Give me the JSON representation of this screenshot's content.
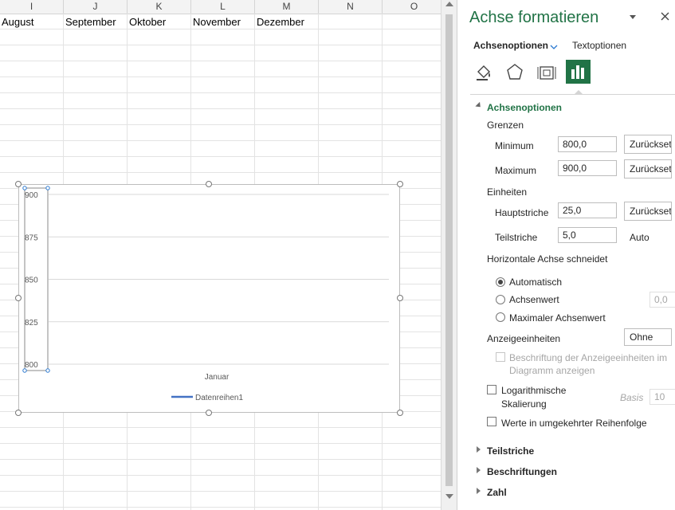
{
  "sheet": {
    "columns": [
      "I",
      "J",
      "K",
      "L",
      "M",
      "N",
      "O"
    ],
    "row1": [
      "August",
      "September",
      "Oktober",
      "November",
      "Dezember"
    ]
  },
  "chart": {
    "category_label": "Januar",
    "legend": "Datenreihen1",
    "series_color": "#4472c4"
  },
  "chart_data": {
    "type": "line",
    "categories": [
      "Januar"
    ],
    "series": [
      {
        "name": "Datenreihen1",
        "values": []
      }
    ],
    "ylim": [
      800,
      900
    ],
    "yticks": [
      900,
      875,
      850,
      825,
      800
    ],
    "grid": true,
    "legend_position": "bottom"
  },
  "pane": {
    "title": "Achse formatieren",
    "tab_axis": "Achsenoptionen",
    "tab_text": "Textoptionen",
    "accent": "#217346",
    "section_axis": "Achsenoptionen",
    "bounds": {
      "header": "Grenzen",
      "min_label": "Minimum",
      "min_value": "800,0",
      "min_btn": "Zurücksetzen",
      "max_label": "Maximum",
      "max_value": "900,0",
      "max_btn": "Zurücksetzen"
    },
    "units": {
      "header": "Einheiten",
      "major_label": "Hauptstriche",
      "major_value": "25,0",
      "major_btn": "Zurücksetzen",
      "minor_label": "Teilstriche",
      "minor_value": "5,0",
      "minor_auto": "Auto"
    },
    "cross": {
      "header": "Horizontale Achse schneidet",
      "opt_auto": "Automatisch",
      "opt_value": "Achsenwert",
      "opt_value_field": "0,0",
      "opt_max": "Maximaler Achsenwert"
    },
    "display_units": {
      "label": "Anzeigeeinheiten",
      "value": "Ohne",
      "show_label_line1": "Beschriftung der Anzeigeeinheiten im",
      "show_label_line2": "Diagramm anzeigen"
    },
    "log": {
      "label_line1": "Logarithmische",
      "label_line2": "Skalierung",
      "base_label": "Basis",
      "base_value": "10"
    },
    "reverse_label": "Werte in umgekehrter Reihenfolge",
    "sections": [
      "Teilstriche",
      "Beschriftungen",
      "Zahl"
    ]
  }
}
